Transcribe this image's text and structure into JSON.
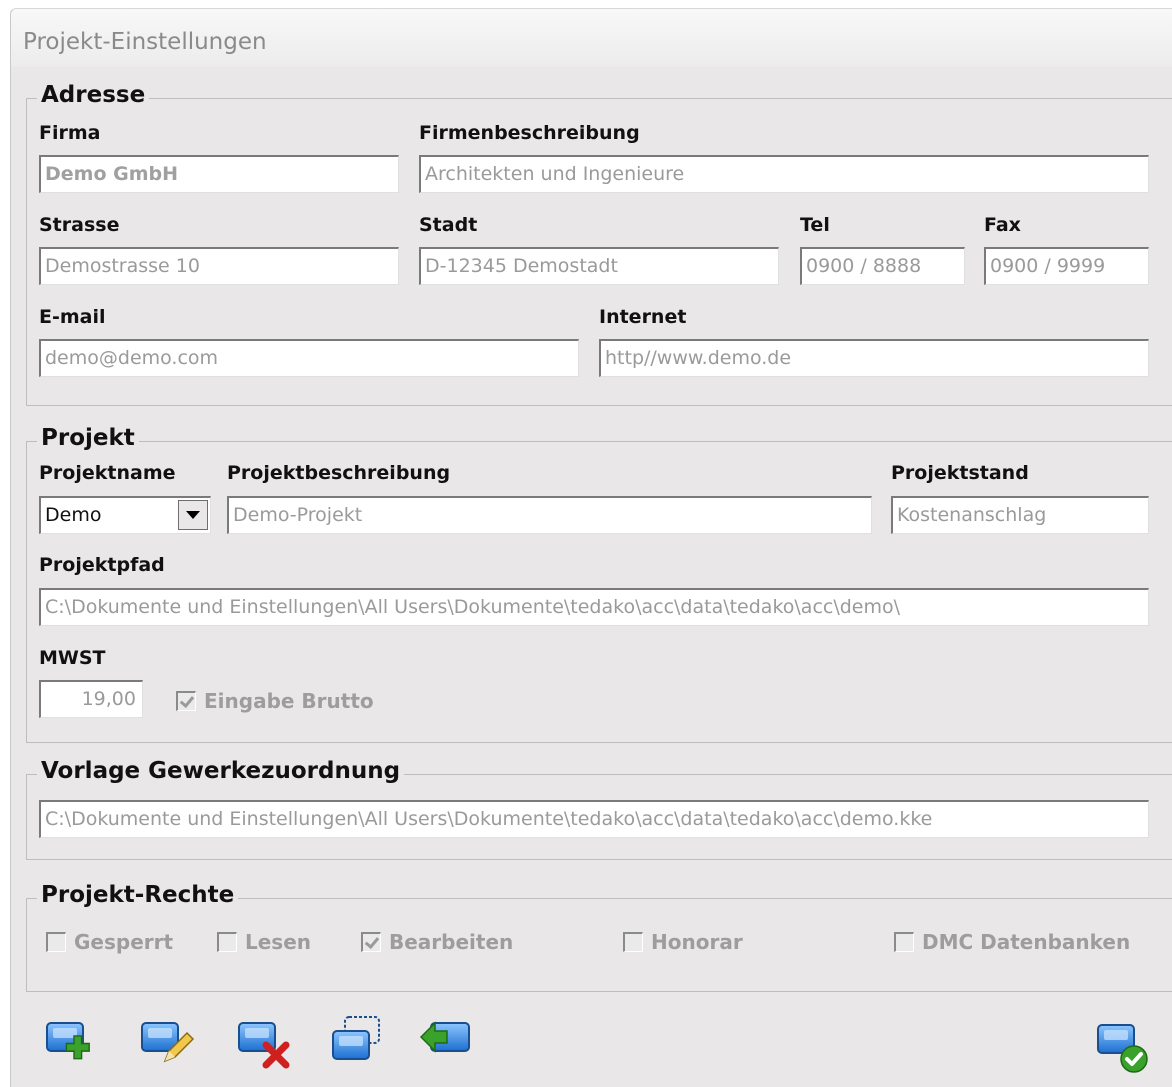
{
  "window": {
    "title": "Projekt-Einstellungen"
  },
  "adresse": {
    "legend": "Adresse",
    "firma_label": "Firma",
    "firma_value": "Demo GmbH",
    "beschreibung_label": "Firmenbeschreibung",
    "beschreibung_value": "Architekten und Ingenieure",
    "strasse_label": "Strasse",
    "strasse_value": "Demostrasse 10",
    "stadt_label": "Stadt",
    "stadt_value": "D-12345 Demostadt",
    "tel_label": "Tel",
    "tel_value": "0900 / 8888",
    "fax_label": "Fax",
    "fax_value": "0900 / 9999",
    "email_label": "E-mail",
    "email_value": "demo@demo.com",
    "internet_label": "Internet",
    "internet_value": "http//www.demo.de"
  },
  "projekt": {
    "legend": "Projekt",
    "name_label": "Projektname",
    "name_value": "Demo",
    "beschreibung_label": "Projektbeschreibung",
    "beschreibung_value": "Demo-Projekt",
    "stand_label": "Projektstand",
    "stand_value": "Kostenanschlag",
    "pfad_label": "Projektpfad",
    "pfad_value": "C:\\Dokumente und Einstellungen\\All Users\\Dokumente\\tedako\\acc\\data\\tedako\\acc\\demo\\",
    "mwst_label": "MWST",
    "mwst_value": "19,00",
    "brutto_label": "Eingabe Brutto",
    "brutto_checked": true
  },
  "vorlage": {
    "legend": "Vorlage Gewerkezuordnung",
    "value": "C:\\Dokumente und Einstellungen\\All Users\\Dokumente\\tedako\\acc\\data\\tedako\\acc\\demo.kke"
  },
  "rechte": {
    "legend": "Projekt-Rechte",
    "items": [
      {
        "label": "Gesperrt",
        "checked": false
      },
      {
        "label": "Lesen",
        "checked": false
      },
      {
        "label": "Bearbeiten",
        "checked": true
      },
      {
        "label": "Honorar",
        "checked": false
      },
      {
        "label": "DMC Datenbanken",
        "checked": false
      }
    ]
  },
  "toolbar": {
    "icons": [
      "add-icon",
      "edit-icon",
      "delete-icon",
      "copy-icon",
      "import-icon",
      "ok-icon"
    ]
  },
  "colors": {
    "window_bg": "#e9e7e8",
    "icon_blue": "#2f7fd6",
    "icon_green": "#3aa12b",
    "icon_red": "#d01f1f"
  }
}
